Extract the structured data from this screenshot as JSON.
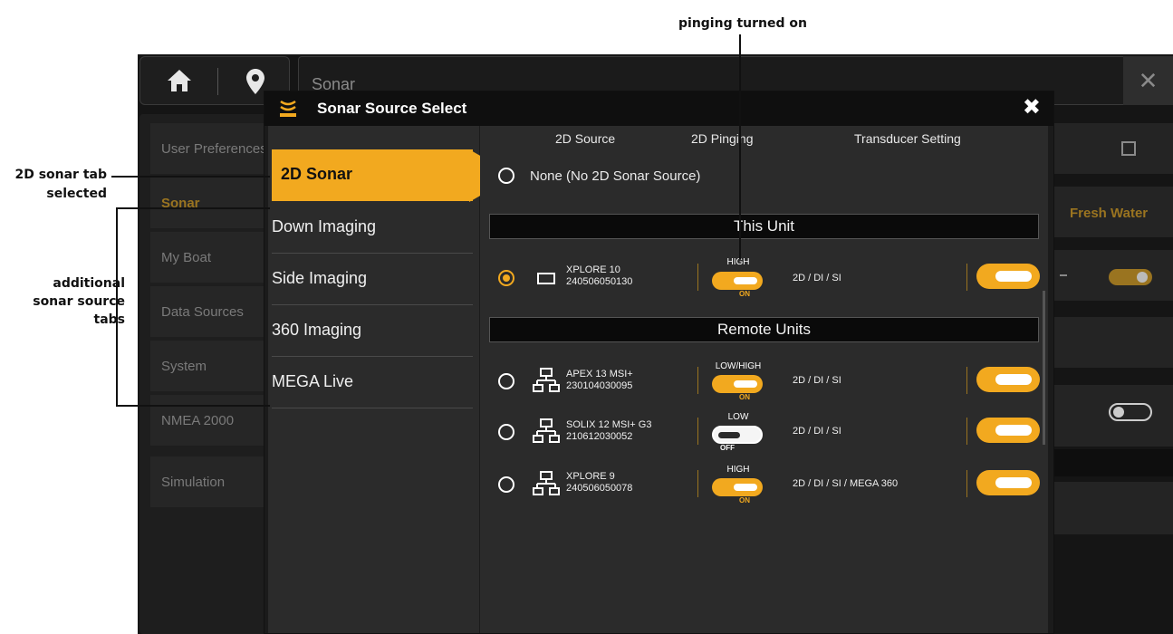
{
  "callouts": {
    "pinging": "pinging turned on",
    "tab_line1": "2D sonar tab",
    "tab_line2": "selected",
    "additional_line1": "additional",
    "additional_line2": "sonar source",
    "additional_line3": "tabs"
  },
  "background": {
    "title": "Sonar",
    "menu": [
      "User Preferences",
      "Sonar",
      "My Boat",
      "Data Sources",
      "System",
      "NMEA 2000",
      "Simulation"
    ],
    "water": "Fresh Water"
  },
  "dialog": {
    "title": "Sonar Source Select",
    "tabs": [
      "2D Sonar",
      "Down Imaging",
      "Side Imaging",
      "360 Imaging",
      "MEGA Live"
    ],
    "selected_tab": "2D Sonar",
    "columns": [
      "2D Source",
      "2D Pinging",
      "Transducer Setting"
    ],
    "none_option": "None (No 2D Sonar Source)",
    "this_unit_label": "This Unit",
    "remote_units_label": "Remote Units",
    "units": [
      {
        "name": "XPLORE 10",
        "serial": "240506050130",
        "ping_level": "HIGH",
        "ping_state": "ON",
        "frequencies": "2D / DI / SI",
        "selected": true
      },
      {
        "name": "APEX 13 MSI+",
        "serial": "230104030095",
        "ping_level": "LOW/HIGH",
        "ping_state": "ON",
        "frequencies": "2D / DI / SI",
        "selected": false
      },
      {
        "name": "SOLIX 12 MSI+ G3",
        "serial": "210612030052",
        "ping_level": "LOW",
        "ping_state": "OFF",
        "frequencies": "2D / DI / SI",
        "selected": false
      },
      {
        "name": "XPLORE 9",
        "serial": "240506050078",
        "ping_level": "HIGH",
        "ping_state": "ON",
        "frequencies": "2D / DI / SI / MEGA 360",
        "selected": false
      }
    ]
  },
  "colors": {
    "accent": "#f2a91f",
    "panel": "#2b2b2b",
    "header": "#0f0f0f"
  }
}
